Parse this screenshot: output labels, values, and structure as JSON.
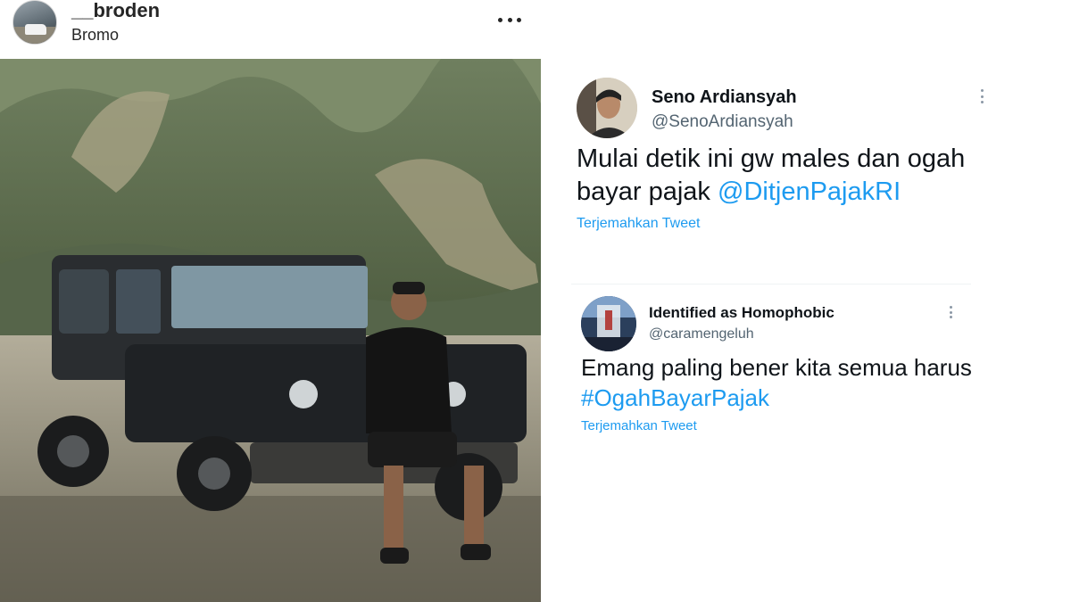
{
  "instagram": {
    "username": "__broden",
    "location": "Bromo",
    "more_icon": "more-horizontal-icon"
  },
  "tweets": [
    {
      "name": "Seno Ardiansyah",
      "handle": "@SenoArdiansyah",
      "text_before": "Mulai detik ini gw males dan ogah bayar pajak",
      "mention": "@DitjenPajakRI",
      "translate_label": "Terjemahkan Tweet",
      "more_icon": "more-vertical-icon"
    },
    {
      "name": "Identified as Homophobic",
      "handle": "@caramengeluh",
      "text_before": "Emang paling bener kita semua harus",
      "mention": "#OgahBayarPajak",
      "translate_label": "Terjemahkan Tweet",
      "more_icon": "more-vertical-icon"
    }
  ],
  "colors": {
    "link": "#1d9bf0",
    "text": "#0f1419",
    "secondary": "#536471",
    "divider": "#eff3f4"
  }
}
